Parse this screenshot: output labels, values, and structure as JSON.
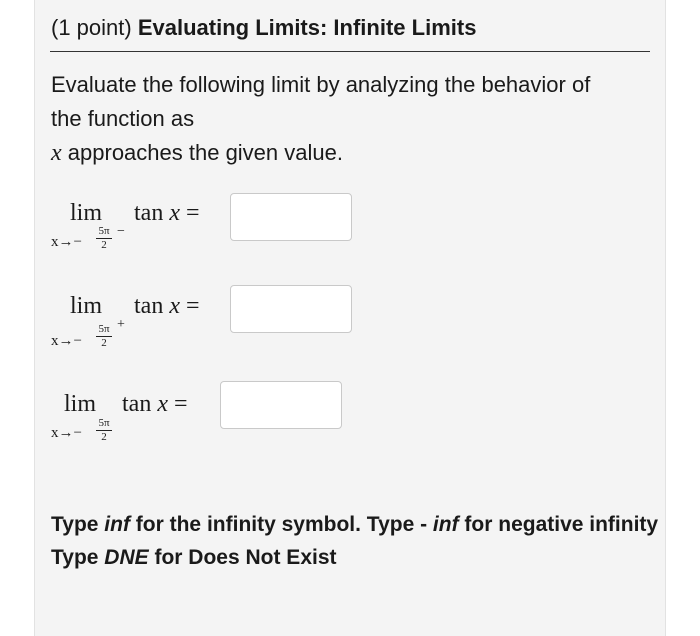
{
  "header": {
    "points": "(1 point)",
    "title": "Evaluating Limits: Infinite Limits"
  },
  "prompt": {
    "line1": "Evaluate the following limit by analyzing the behavior of",
    "line2": "the function as",
    "var": "x",
    "line3": "approaches the given value."
  },
  "limits": [
    {
      "lim": "lim",
      "arrow": "x→−",
      "num": "5π",
      "den": "2",
      "side": "−",
      "func": "tan",
      "fvar": "x",
      "eq": "=",
      "answer": ""
    },
    {
      "lim": "lim",
      "arrow": "x→−",
      "num": "5π",
      "den": "2",
      "side": "+",
      "func": "tan",
      "fvar": "x",
      "eq": "=",
      "answer": ""
    },
    {
      "lim": "lim",
      "arrow": "x→−",
      "num": "5π",
      "den": "2",
      "side": "",
      "func": "tan",
      "fvar": "x",
      "eq": "=",
      "answer": ""
    }
  ],
  "notes": {
    "n1_a": "Type ",
    "n1_b": "inf",
    "n1_c": " for the infinity symbol. Type - ",
    "n1_d": "inf",
    "n1_e": " for negative infinity",
    "n2_a": "Type ",
    "n2_b": "DNE",
    "n2_c": " for Does Not Exist"
  }
}
